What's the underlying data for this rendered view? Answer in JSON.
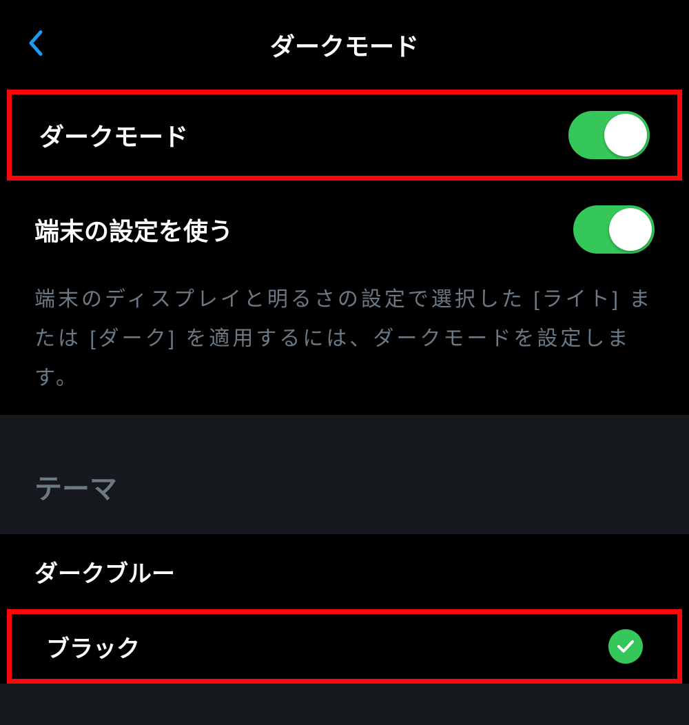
{
  "header": {
    "title": "ダークモード"
  },
  "settings": {
    "dark_mode": {
      "label": "ダークモード",
      "enabled": true
    },
    "use_device": {
      "label": "端末の設定を使う",
      "enabled": true,
      "description": "端末のディスプレイと明るさの設定で選択した [ライト] または [ダーク] を適用するには、ダークモードを設定します。"
    }
  },
  "theme": {
    "section_title": "テーマ",
    "options": [
      {
        "label": "ダークブルー",
        "selected": false
      },
      {
        "label": "ブラック",
        "selected": true
      }
    ]
  },
  "colors": {
    "accent_blue": "#1d9bf0",
    "toggle_green": "#35c759",
    "highlight_red": "#ff0408"
  }
}
